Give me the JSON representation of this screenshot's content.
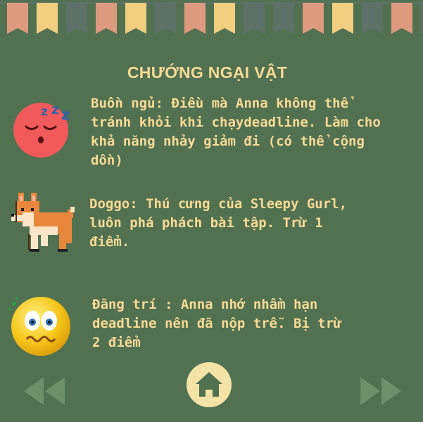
{
  "page": {
    "title": "CHƯỚNG NGẠI VẬT"
  },
  "obstacles": [
    {
      "icon": "sleepy-face-icon",
      "text": "Buồn ngủ: Điều mà Anna không thể\ntránh khỏi khi chạydeadline. Làm cho\nkhả năng nhảy giảm đi (có thể cộng\ndồn)"
    },
    {
      "icon": "corgi-dog-icon",
      "text": "Doggo: Thú cưng của Sleepy Gurl,\nluôn phá phách bài tập. Trừ 1\nđiểm."
    },
    {
      "icon": "dizzy-face-icon",
      "text": "Đãng trí : Anna nhớ nhầm hạn\ndeadline nên đã nộp trễ. Bị trừ\n2 điểm"
    }
  ],
  "nav": {
    "prev": "rewind-icon",
    "home": "home-icon",
    "next": "fast-forward-icon"
  },
  "colors": {
    "background": "#527151",
    "text": "#f6da95",
    "home_button": "#f3e3a6",
    "flag_colors": [
      "#de9a7e",
      "#f2ce80",
      "#5d7169"
    ]
  }
}
